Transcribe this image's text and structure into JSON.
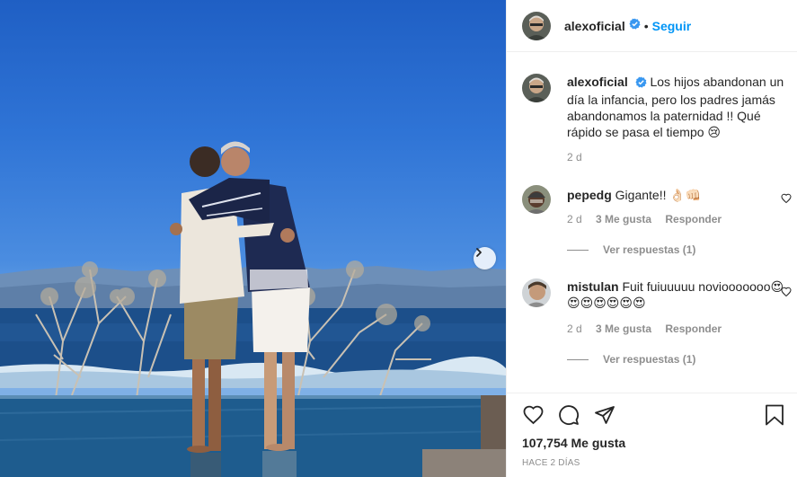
{
  "post": {
    "image_alt": "",
    "next_icon": "chevron-right-icon"
  },
  "header": {
    "username": "alexoficial",
    "separator": "•",
    "follow_label": "Seguir",
    "verified_icon": "verified-badge-icon"
  },
  "caption": {
    "username": "alexoficial",
    "text": "Los hijos abandonan un día la infancia, pero los padres jamás abandonamos la paternidad !! Qué rápido se pasa el tiempo 😢",
    "time": "2 d"
  },
  "comments": [
    {
      "username": "pepedg",
      "text": "Gigante!! 👌🏻👊🏻",
      "time": "2 d",
      "likes": "3 Me gusta",
      "reply_label": "Responder",
      "replies_label": "Ver respuestas (1)"
    },
    {
      "username": "mistulan",
      "text": "Fuit fuiuuuuu noviooooooo😍😍😍😍😍😍😍",
      "time": "2 d",
      "likes": "3 Me gusta",
      "reply_label": "Responder",
      "replies_label": "Ver respuestas (1)"
    }
  ],
  "footer": {
    "likes": "107,754 Me gusta",
    "time_ago": "HACE 2 DÍAS",
    "icons": [
      "heart-icon",
      "comment-icon",
      "share-icon",
      "bookmark-icon"
    ]
  },
  "colors": {
    "link": "#0095f6",
    "verified": "#3897f0",
    "muted": "#8e8e8e",
    "text": "#262626"
  }
}
